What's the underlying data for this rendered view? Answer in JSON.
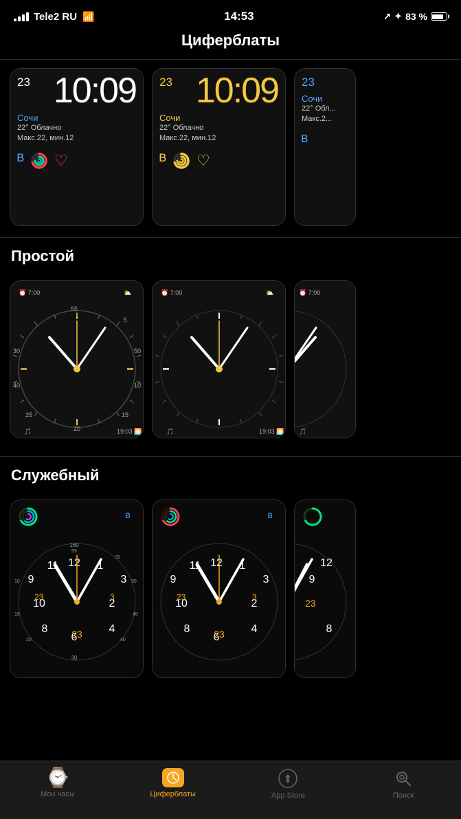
{
  "statusBar": {
    "carrier": "Tele2 RU",
    "time": "14:53",
    "battery": "83 %"
  },
  "pageTitle": "Циферблаты",
  "topFaces": [
    {
      "id": "infograph-blue",
      "style": "infograph",
      "colorAccent": "blue",
      "date": "23",
      "time": "10:09",
      "city": "Сочи",
      "weather": "22° Облачно",
      "details": "Макс.22, мин.12"
    },
    {
      "id": "infograph-yellow",
      "style": "infograph",
      "colorAccent": "yellow",
      "date": "23",
      "time": "10:09",
      "city": "Сочи",
      "weather": "22° Облачно",
      "details": "Макс.22, мин.12"
    },
    {
      "id": "infograph-partial",
      "style": "infograph-partial",
      "colorAccent": "blue",
      "date": "23",
      "city": "Сочи",
      "weather": "22° Обл...",
      "details": "Макс.2..."
    }
  ],
  "sections": [
    {
      "title": "Простой",
      "faces": [
        {
          "id": "simple-1",
          "alarm": "7:00",
          "time2": "19:03",
          "hasColorBand": true
        },
        {
          "id": "simple-2",
          "alarm": "7:00",
          "time2": "19:03",
          "hasColorBand": false
        },
        {
          "id": "simple-3",
          "alarm": "7:00",
          "partial": true
        }
      ]
    },
    {
      "title": "Служебный",
      "faces": [
        {
          "id": "utility-1",
          "date": "23",
          "hasGreenRing": true
        },
        {
          "id": "utility-2",
          "date": "23",
          "hasRedRing": true
        },
        {
          "id": "utility-3",
          "partial": true
        }
      ]
    }
  ],
  "tabs": [
    {
      "id": "my-watch",
      "label": "Мои часы",
      "icon": "⌚",
      "active": false
    },
    {
      "id": "faces",
      "label": "Циферблаты",
      "icon": "🟧",
      "active": true
    },
    {
      "id": "app-store",
      "label": "App Store",
      "icon": "⬆",
      "active": false
    },
    {
      "id": "search",
      "label": "Поиск",
      "icon": "🔍",
      "active": false
    }
  ]
}
